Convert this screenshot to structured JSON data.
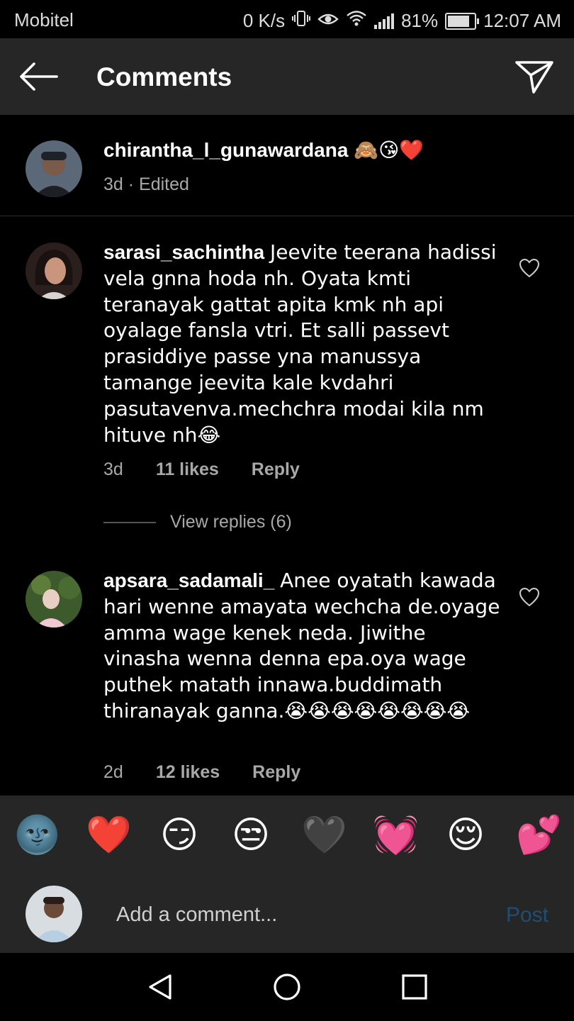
{
  "status_bar": {
    "carrier": "Mobitel",
    "net_speed": "0 K/s",
    "battery": "81%",
    "time": "12:07 AM"
  },
  "header": {
    "title": "Comments",
    "back_icon": "arrow-left-icon",
    "send_icon": "paper-plane-icon"
  },
  "caption": {
    "username": "chirantha_l_gunawardana",
    "text": "🙈😘❤️",
    "meta": "3d · Edited"
  },
  "comments": [
    {
      "username": "sarasi_sachintha",
      "text": "Jeevite teerana hadissi vela gnna hoda nh. Oyata kmti teranayak gattat apita kmk nh api oyalage fansla vtri. Et salli passevt  prasiddiye passe yna manussya tamange jeevita kale kvdahri pasutavenva.mechchra modai kila nm hituve nh😂",
      "time": "3d",
      "likes": "11 likes",
      "reply_label": "Reply"
    },
    {
      "username": "apsara_sadamali_",
      "text": "Anee  oyatath kawada hari wenne amayata wechcha de.oyage amma wage kenek neda. Jiwithe vinasha wenna denna epa.oya wage puthek matath innawa.buddimath thiranayak ganna.😭😭😭😭😭😭😭😭",
      "time": "2d",
      "likes": "12 likes",
      "reply_label": "Reply"
    }
  ],
  "view_replies": "View replies (6)",
  "emoji_bar": [
    "🌚",
    "❤️",
    "😏",
    "😒",
    "🖤",
    "💓",
    "😌",
    "💕"
  ],
  "comment_input": {
    "placeholder": "Add a comment..."
  },
  "post_label": "Post",
  "colors": {
    "background": "#000000",
    "panel": "#262626",
    "muted": "#a8a8a8",
    "post_disabled": "#1f4d73"
  }
}
